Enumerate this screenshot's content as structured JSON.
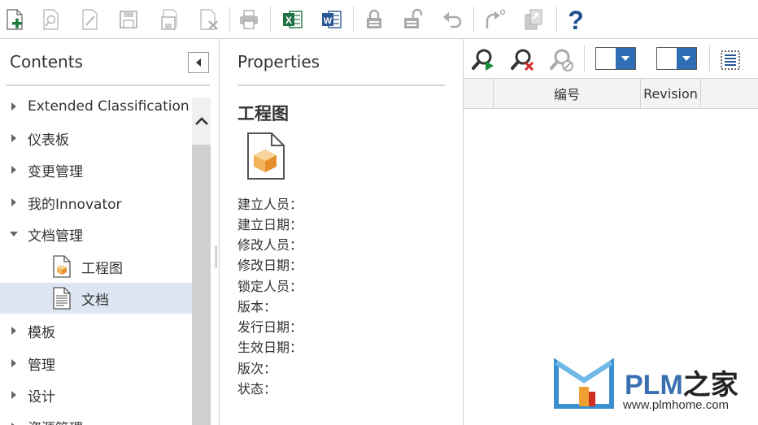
{
  "toolbar": {
    "buttons": [
      {
        "icon": "new-item-icon"
      },
      {
        "icon": "search-item-icon"
      },
      {
        "icon": "edit-icon"
      },
      {
        "icon": "save-icon"
      },
      {
        "icon": "save-close-icon"
      },
      {
        "icon": "delete-icon"
      },
      {
        "icon": "print-icon"
      },
      {
        "icon": "excel-icon",
        "label": "X"
      },
      {
        "icon": "word-icon",
        "label": "W"
      },
      {
        "icon": "lock-icon"
      },
      {
        "icon": "unlock-icon"
      },
      {
        "icon": "undo-icon"
      },
      {
        "icon": "promote-icon"
      },
      {
        "icon": "version-icon"
      },
      {
        "icon": "help-icon",
        "label": "?"
      }
    ],
    "accent_green": "#1d7a3a",
    "excel_green": "#1f7244",
    "word_blue": "#2b5797",
    "help_blue": "#1f4f8f"
  },
  "contents": {
    "title": "Contents",
    "items": [
      {
        "label": "Extended Classification",
        "expanded": false
      },
      {
        "label": "仪表板",
        "expanded": false
      },
      {
        "label": "变更管理",
        "expanded": false
      },
      {
        "label": "我的Innovator",
        "expanded": false
      },
      {
        "label": "文档管理",
        "expanded": true
      },
      {
        "label": "工程图",
        "child": true,
        "icon": "cad-document-icon"
      },
      {
        "label": "文档",
        "child": true,
        "icon": "text-document-icon",
        "selected": true
      },
      {
        "label": "模板",
        "expanded": false
      },
      {
        "label": "管理",
        "expanded": false
      },
      {
        "label": "设计",
        "expanded": false
      },
      {
        "label": "资源管理",
        "expanded": false
      }
    ],
    "selected_bg": "#dde6f2"
  },
  "properties": {
    "title": "Properties",
    "heading": "工程图",
    "fields": [
      "建立人员：",
      "建立日期：",
      "修改人员：",
      "修改日期：",
      "锁定人员：",
      "版本：",
      "发行日期：",
      "生效日期：",
      "版次：",
      "状态："
    ]
  },
  "grid": {
    "columns": [
      {
        "label": ""
      },
      {
        "label": "编号"
      },
      {
        "label": "Revision"
      }
    ],
    "tools": [
      "run-search-icon",
      "clear-search-icon",
      "stop-search-icon"
    ],
    "dropdown_blue": "#2f6db5"
  },
  "watermark": {
    "brand": "PLM",
    "brand_cn": "之家",
    "url": "www.plmhome.com"
  }
}
